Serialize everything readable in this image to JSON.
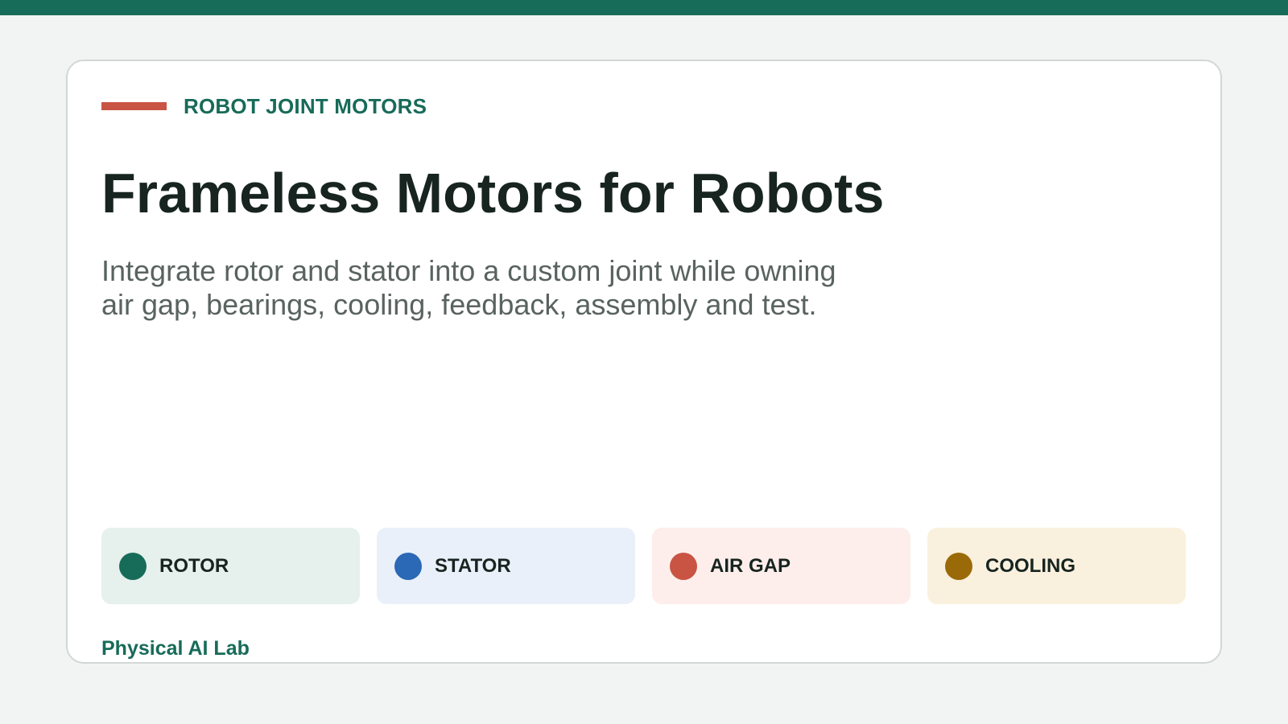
{
  "header": {
    "eyebrow": "ROBOT JOINT MOTORS",
    "title": "Frameless Motors for Robots",
    "subtitle": "Integrate rotor and stator into a custom joint while owning air gap, bearings, cooling, feedback, assembly and test."
  },
  "chips": [
    {
      "label": "ROTOR",
      "icon": "dot-icon",
      "dot_color": "#176b59",
      "bg_color": "#e6f0ed"
    },
    {
      "label": "STATOR",
      "icon": "dot-icon",
      "dot_color": "#2b68b5",
      "bg_color": "#e9f0f9"
    },
    {
      "label": "AIR GAP",
      "icon": "dot-icon",
      "dot_color": "#c95444",
      "bg_color": "#fdeeeb"
    },
    {
      "label": "COOLING",
      "icon": "dot-icon",
      "dot_color": "#9a6a08",
      "bg_color": "#faf0de"
    }
  ],
  "footer": {
    "brand": "Physical AI Lab"
  },
  "colors": {
    "top_bar": "#176b59",
    "accent_rule": "#c95444",
    "brand": "#176b59",
    "page_background": "#f2f4f3",
    "card_background": "#ffffff"
  }
}
